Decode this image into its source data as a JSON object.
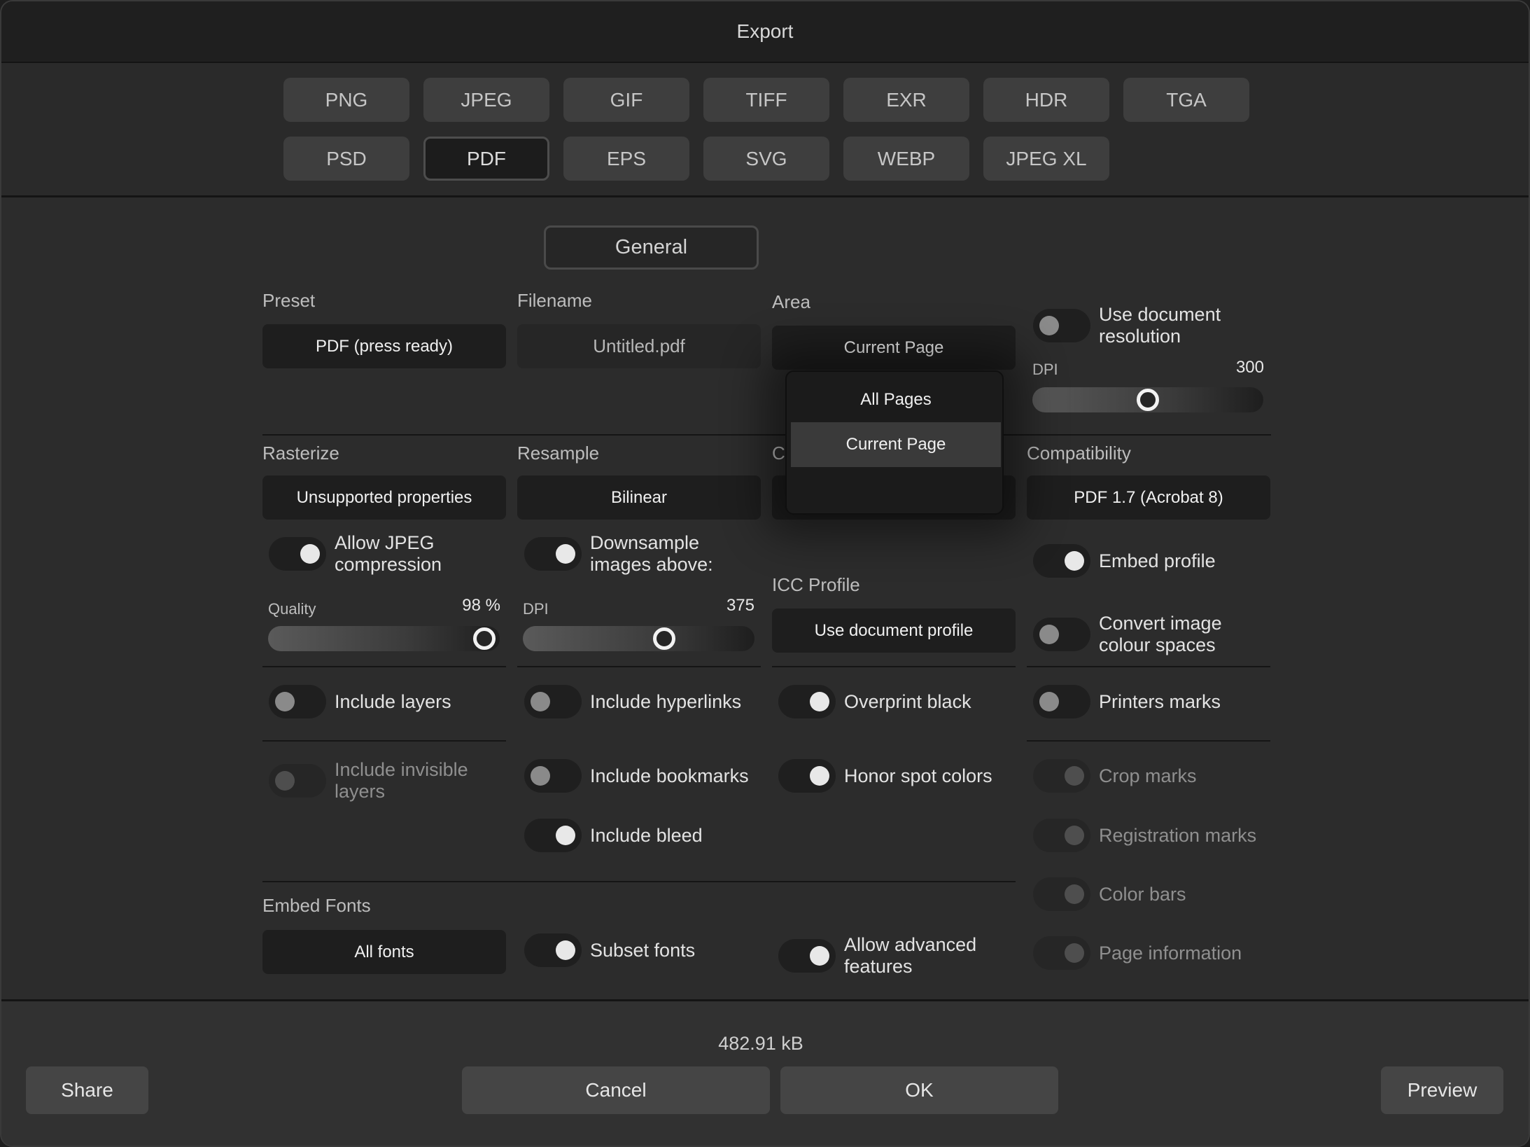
{
  "window": {
    "title": "Export"
  },
  "formats": {
    "row1": [
      "PNG",
      "JPEG",
      "GIF",
      "TIFF",
      "EXR",
      "HDR",
      "TGA"
    ],
    "row2": [
      "PSD",
      "PDF",
      "EPS",
      "SVG",
      "WEBP",
      "JPEG XL"
    ],
    "selected": "PDF"
  },
  "section": {
    "label": "General"
  },
  "preset": {
    "label": "Preset",
    "value": "PDF (press ready)"
  },
  "filename": {
    "label": "Filename",
    "value": "Untitled.pdf"
  },
  "area": {
    "label": "Area",
    "value": "Current Page",
    "options": [
      "All Pages",
      "Current Page"
    ],
    "hidden_label_initial": "C"
  },
  "resolution": {
    "use_document_label": "Use document resolution",
    "use_document_on": false,
    "dpi_label": "DPI",
    "dpi_value": "300",
    "dpi_fraction": 0.5
  },
  "rasterize": {
    "label": "Rasterize",
    "value": "Unsupported properties"
  },
  "resample": {
    "label": "Resample",
    "value": "Bilinear"
  },
  "compatibility": {
    "label": "Compatibility",
    "value": "PDF 1.7 (Acrobat 8)"
  },
  "jpeg": {
    "label": "Allow JPEG compression",
    "on": true,
    "quality_label": "Quality",
    "quality_value": "98 %",
    "quality_fraction": 0.98
  },
  "downsample": {
    "label": "Downsample images above:",
    "on": true,
    "dpi_label": "DPI",
    "dpi_value": "375",
    "dpi_fraction": 0.6
  },
  "icc": {
    "label": "ICC Profile",
    "value": "Use document profile"
  },
  "embed_profile": {
    "label": "Embed profile",
    "on": true
  },
  "convert_colour": {
    "label": "Convert image colour spaces",
    "on": false
  },
  "toggles": {
    "include_layers": "Include layers",
    "include_invisible_layers": "Include invisible layers",
    "include_hyperlinks": "Include hyperlinks",
    "include_bookmarks": "Include bookmarks",
    "include_bleed": "Include bleed",
    "overprint_black": "Overprint black",
    "honor_spot_colors": "Honor spot colors",
    "printers_marks": "Printers marks",
    "crop_marks": "Crop marks",
    "registration_marks": "Registration marks",
    "color_bars": "Color bars",
    "page_information": "Page information",
    "subset_fonts": "Subset fonts",
    "allow_advanced_features": "Allow advanced features"
  },
  "embed_fonts": {
    "label": "Embed Fonts",
    "value": "All fonts"
  },
  "footer": {
    "file_size": "482.91 kB",
    "share": "Share",
    "cancel": "Cancel",
    "ok": "OK",
    "preview": "Preview"
  }
}
